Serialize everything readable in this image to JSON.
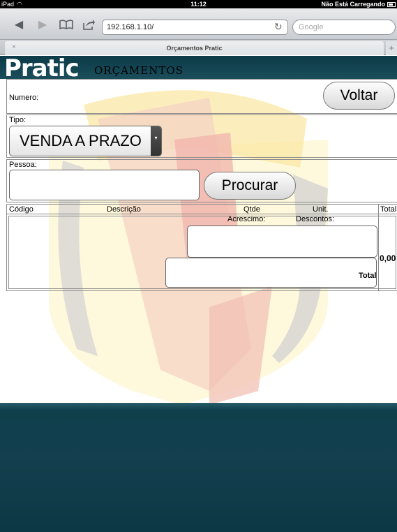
{
  "status_bar": {
    "device": "iPad",
    "time": "11:12",
    "loading_status": "Não Está Carregando"
  },
  "browser": {
    "url": "192.168.1.10/",
    "search_placeholder": "Google",
    "tab_title": "Orçamentos Pratic",
    "tab_close": "×",
    "tab_add": "+"
  },
  "header": {
    "logo": "Pratic",
    "logo_subtitle": "ORÇAMENTOS"
  },
  "form": {
    "numero_label": "Numero:",
    "voltar_button": "Voltar",
    "tipo_label": "Tipo:",
    "tipo_selected": "VENDA A PRAZO",
    "pessoa_label": "Pessoa:",
    "pessoa_value": "",
    "procurar_button": "Procurar"
  },
  "items_table": {
    "columns": [
      "Código",
      "Descrição",
      "Qtde",
      "Unit.",
      "Total"
    ],
    "acrescimo_label": "Acrescimo:",
    "descontos_label": "Descontos:",
    "total_label": "Total",
    "total_value": "0,00"
  },
  "colors": {
    "header_bg": "#0d3b48",
    "footer_bg": "#0f3f4c"
  }
}
